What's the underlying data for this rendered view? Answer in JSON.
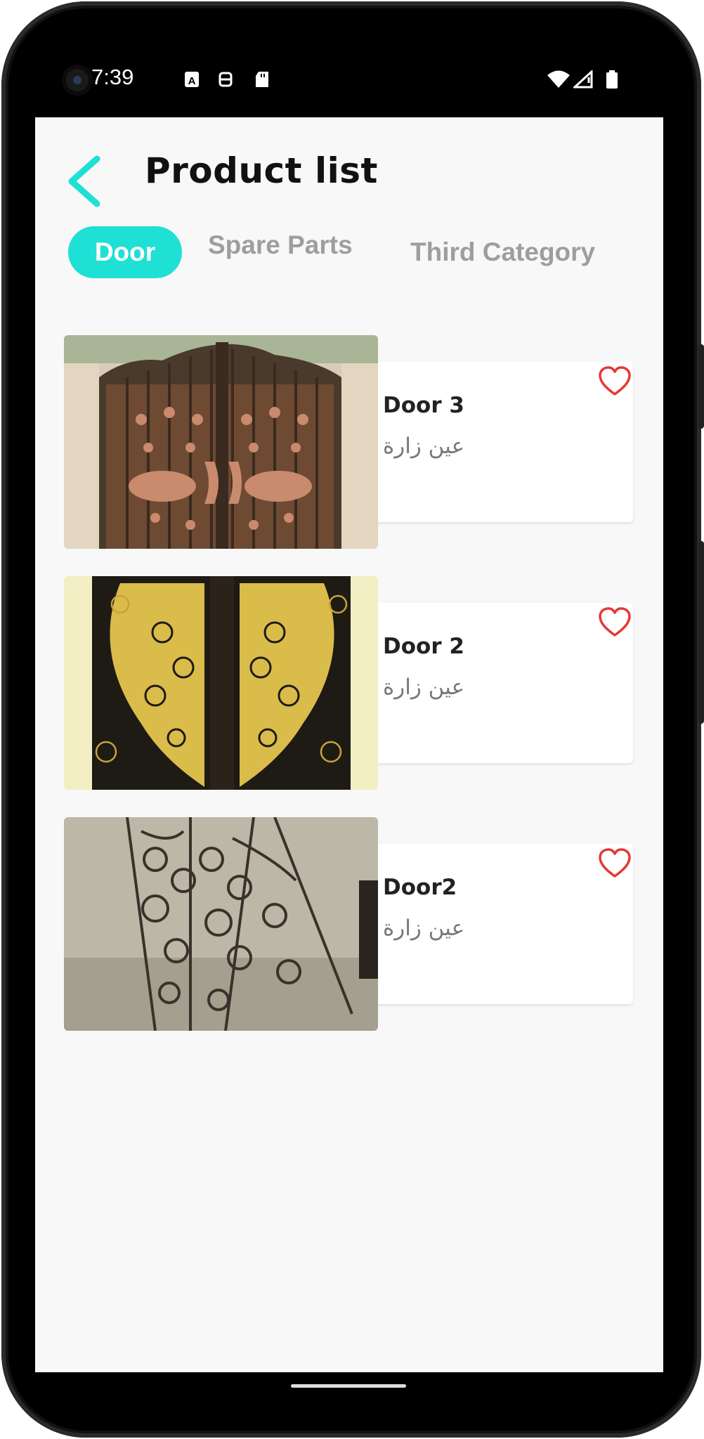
{
  "status_bar": {
    "time": "7:39"
  },
  "header": {
    "title": "Product list"
  },
  "tabs": [
    {
      "label": "Door",
      "active": true
    },
    {
      "label": "Spare Parts",
      "active": false
    },
    {
      "label": "Third Category",
      "active": false
    }
  ],
  "products": [
    {
      "name": "Door 3",
      "location": "عين زارة"
    },
    {
      "name": "Door 2",
      "location": "عين زارة"
    },
    {
      "name": "Door2",
      "location": "عين زارة"
    }
  ],
  "colors": {
    "accent": "#1fe0d4",
    "heart": "#e53935",
    "background": "#f8f8f8"
  }
}
